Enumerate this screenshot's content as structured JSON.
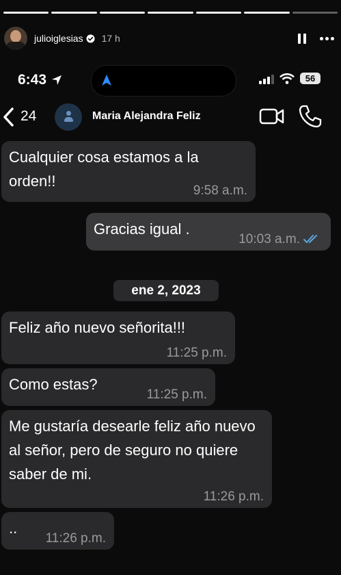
{
  "story": {
    "username": "julioiglesias",
    "age": "17 h",
    "progress_segments": 7
  },
  "status_bar": {
    "time": "6:43",
    "battery": "56"
  },
  "chat_header": {
    "unread_count": "24",
    "contact_name": "Maria Alejandra Feliz"
  },
  "messages": [
    {
      "direction": "in",
      "text": "Cualquier cosa estamos a la orden!!",
      "time": "9:58 a.m."
    },
    {
      "direction": "out",
      "text": "Gracias igual .",
      "time": "10:03 a.m.",
      "read": true
    },
    {
      "type": "date",
      "text": "ene 2, 2023"
    },
    {
      "direction": "in",
      "text": "Feliz año nuevo señorita!!!",
      "time": "11:25 p.m."
    },
    {
      "direction": "in",
      "text": "Como estas?",
      "time": "11:25 p.m."
    },
    {
      "direction": "in",
      "text": "Me gustaría desearle feliz año nuevo al señor, pero de seguro no quiere saber de mi.",
      "time": "11:26 p.m."
    },
    {
      "direction": "in",
      "text": "..",
      "time": "11:26 p.m."
    }
  ],
  "colors": {
    "background": "#0b0b0b",
    "bubble_in": "#2a2a2c",
    "bubble_out": "#3a3a3c",
    "read_ticks": "#5aa7e0"
  }
}
